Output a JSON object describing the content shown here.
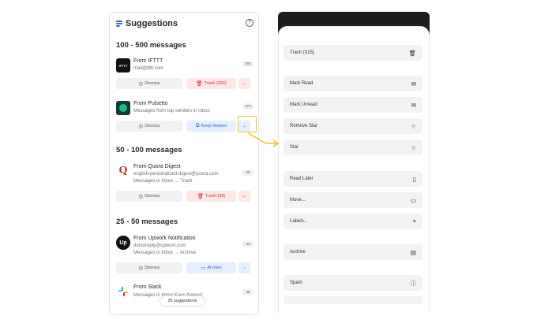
{
  "header": {
    "title": "Suggestions"
  },
  "colors": {
    "accent": "#3d6bd8",
    "danger": "#d32f2f",
    "highlight": "#f2c12e"
  },
  "sections": [
    {
      "title": "100 - 500 messages"
    },
    {
      "title": "50 - 100 messages"
    },
    {
      "title": "25 - 50 messages"
    }
  ],
  "senders": [
    {
      "name": "From IFTTT",
      "sub1": "mail@ifttt.com",
      "count": "202",
      "logo": "IFTTT",
      "dismiss": "Dismiss",
      "action": "Trash (392)"
    },
    {
      "name": "From Pulsetto",
      "sub1": "Messages from top senders in Inbox",
      "count": "373",
      "dismiss": "Dismiss",
      "action": "Keep Newest"
    },
    {
      "name": "From Quora Digest",
      "sub1": "english-personalized-digest@quora.com",
      "sub2": "Messages in Inbox → Trash",
      "count": "58",
      "logo": "Q",
      "dismiss": "Dismiss",
      "action": "Trash (58)"
    },
    {
      "name": "From Upwork Notification",
      "sub1": "donotreply@upwork.com",
      "sub2": "Messages in Inbox → Archive",
      "count": "43",
      "logo": "Up",
      "dismiss": "Dismiss",
      "action": "Archive"
    },
    {
      "name": "From Slack",
      "sub1": "Messages in Inbox Keep Newest",
      "count": "38"
    }
  ],
  "bottom_badge": "25 suggestions",
  "menu": [
    {
      "label": "Trash (315)",
      "icon": "trash-icon"
    },
    {
      "label": "Mark Read",
      "icon": "envelope-open-icon"
    },
    {
      "label": "Mark Unread",
      "icon": "envelope-icon"
    },
    {
      "label": "Remove Star",
      "icon": "star-off-icon"
    },
    {
      "label": "Star",
      "icon": "star-icon"
    },
    {
      "label": "Read Later",
      "icon": "bookmark-icon"
    },
    {
      "label": "Move...",
      "icon": "folder-icon"
    },
    {
      "label": "Labels...",
      "icon": "tag-icon"
    },
    {
      "label": "Archive",
      "icon": "archive-icon"
    },
    {
      "label": "Spam",
      "icon": "spam-icon"
    }
  ]
}
